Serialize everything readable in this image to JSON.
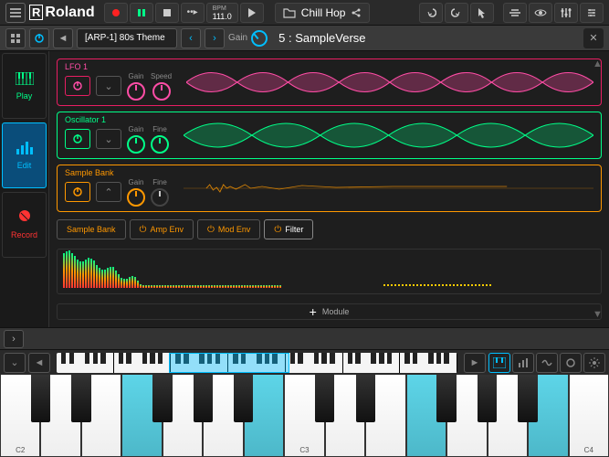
{
  "brand": "Roland",
  "transport": {
    "bpm_label": "BPM",
    "bpm_value": "111.0"
  },
  "song": {
    "name": "Chill Hop"
  },
  "preset": {
    "nav_label": "[ARP-1] 80s Theme",
    "gain_label": "Gain",
    "patch_number": "5",
    "patch_name": "SampleVerse",
    "patch_display": "5 : SampleVerse"
  },
  "sidebar": {
    "play": "Play",
    "edit": "Edit",
    "record": "Record"
  },
  "modules": {
    "lfo": {
      "title": "LFO 1",
      "knob1": "Gain",
      "knob2": "Speed"
    },
    "osc": {
      "title": "Oscillator 1",
      "knob1": "Gain",
      "knob2": "Fine"
    },
    "samp": {
      "title": "Sample Bank",
      "knob1": "Gain",
      "knob2": "Fine"
    }
  },
  "tabs": {
    "sample_bank": "Sample Bank",
    "amp_env": "Amp Env",
    "mod_env": "Mod Env",
    "filter": "Filter"
  },
  "add_module": "Module",
  "keyboard": {
    "c2": "C2",
    "c3": "C3",
    "c4": "C4"
  }
}
